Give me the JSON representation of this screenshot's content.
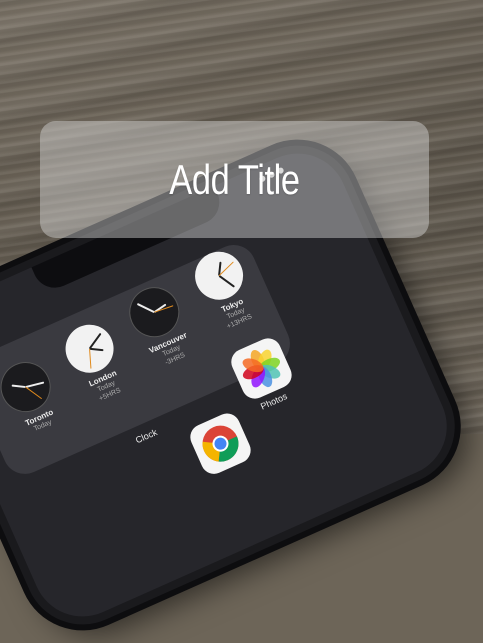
{
  "title_overlay": {
    "text": "Add Title"
  },
  "phone": {
    "world_clocks": [
      {
        "city": "Toronto",
        "day": "Today",
        "offset": ""
      },
      {
        "city": "London",
        "day": "Today",
        "offset": "+5HRS"
      },
      {
        "city": "Vancouver",
        "day": "Today",
        "offset": "-3HRS"
      },
      {
        "city": "Tokyo",
        "day": "Today",
        "offset": "+13HRS"
      }
    ],
    "apps": {
      "clock_label": "Clock",
      "photos_label": "Photos"
    }
  }
}
